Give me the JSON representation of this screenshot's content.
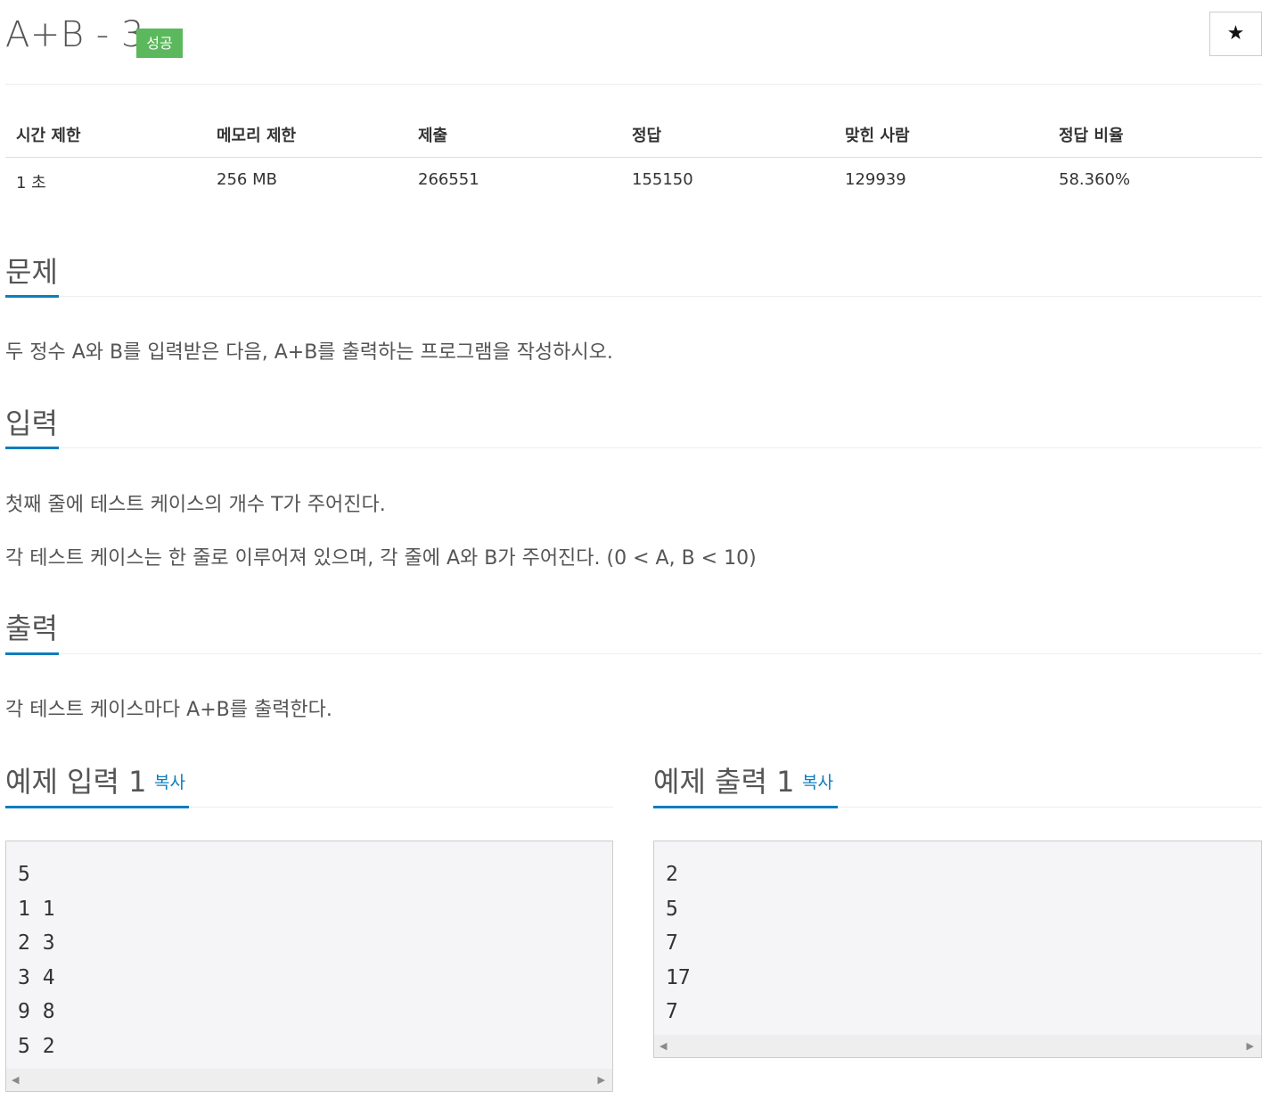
{
  "header": {
    "title": "A+B - 3",
    "badge": "성공",
    "star_icon": "★"
  },
  "info": {
    "headers": [
      "시간 제한",
      "메모리 제한",
      "제출",
      "정답",
      "맞힌 사람",
      "정답 비율"
    ],
    "values": [
      "1 초",
      "256 MB",
      "266551",
      "155150",
      "129939",
      "58.360%"
    ]
  },
  "problem": {
    "title": "문제",
    "text": "두 정수 A와 B를 입력받은 다음, A+B를 출력하는 프로그램을 작성하시오."
  },
  "input": {
    "title": "입력",
    "lines": [
      "첫째 줄에 테스트 케이스의 개수 T가 주어진다.",
      "각 테스트 케이스는 한 줄로 이루어져 있으며, 각 줄에 A와 B가 주어진다. (0 < A, B < 10)"
    ]
  },
  "output": {
    "title": "출력",
    "text": "각 테스트 케이스마다 A+B를 출력한다."
  },
  "sample_input": {
    "title": "예제 입력 1",
    "copy_label": "복사",
    "lines": [
      "5",
      "1 1",
      "2 3",
      "3 4",
      "9 8",
      "5 2"
    ]
  },
  "sample_output": {
    "title": "예제 출력 1",
    "copy_label": "복사",
    "lines": [
      "2",
      "5",
      "7",
      "17",
      "7"
    ]
  },
  "scroll_left_icon": "◀",
  "scroll_right_icon": "▶"
}
